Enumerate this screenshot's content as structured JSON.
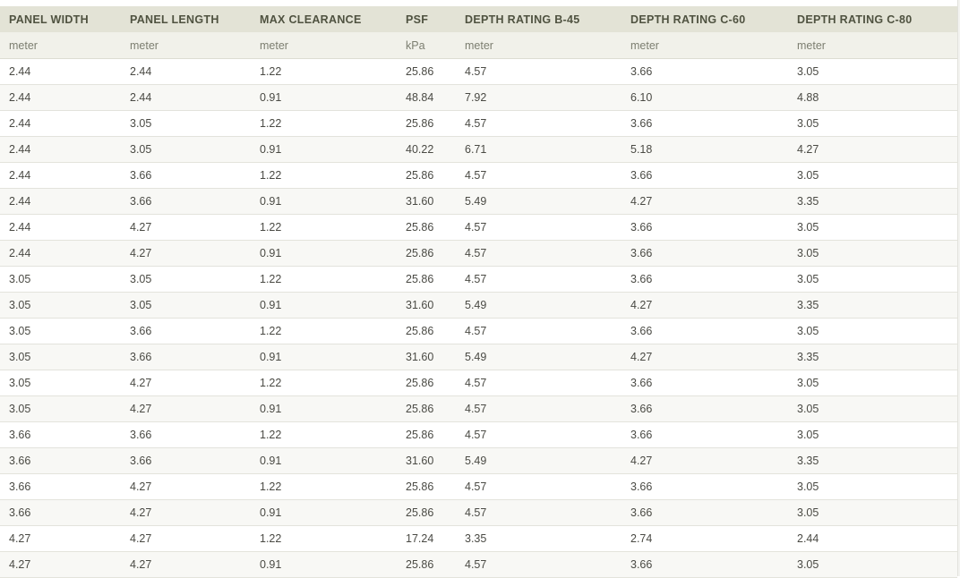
{
  "table": {
    "headers": [
      "PANEL WIDTH",
      "PANEL LENGTH",
      "MAX CLEARANCE",
      "PSF",
      "DEPTH RATING B-45",
      "DEPTH RATING C-60",
      "DEPTH RATING C-80"
    ],
    "units": [
      "meter",
      "meter",
      "meter",
      "kPa",
      "meter",
      "meter",
      "meter"
    ],
    "rows": [
      [
        "2.44",
        "2.44",
        "1.22",
        "25.86",
        "4.57",
        "3.66",
        "3.05"
      ],
      [
        "2.44",
        "2.44",
        "0.91",
        "48.84",
        "7.92",
        "6.10",
        "4.88"
      ],
      [
        "2.44",
        "3.05",
        "1.22",
        "25.86",
        "4.57",
        "3.66",
        "3.05"
      ],
      [
        "2.44",
        "3.05",
        "0.91",
        "40.22",
        "6.71",
        "5.18",
        "4.27"
      ],
      [
        "2.44",
        "3.66",
        "1.22",
        "25.86",
        "4.57",
        "3.66",
        "3.05"
      ],
      [
        "2.44",
        "3.66",
        "0.91",
        "31.60",
        "5.49",
        "4.27",
        "3.35"
      ],
      [
        "2.44",
        "4.27",
        "1.22",
        "25.86",
        "4.57",
        "3.66",
        "3.05"
      ],
      [
        "2.44",
        "4.27",
        "0.91",
        "25.86",
        "4.57",
        "3.66",
        "3.05"
      ],
      [
        "3.05",
        "3.05",
        "1.22",
        "25.86",
        "4.57",
        "3.66",
        "3.05"
      ],
      [
        "3.05",
        "3.05",
        "0.91",
        "31.60",
        "5.49",
        "4.27",
        "3.35"
      ],
      [
        "3.05",
        "3.66",
        "1.22",
        "25.86",
        "4.57",
        "3.66",
        "3.05"
      ],
      [
        "3.05",
        "3.66",
        "0.91",
        "31.60",
        "5.49",
        "4.27",
        "3.35"
      ],
      [
        "3.05",
        "4.27",
        "1.22",
        "25.86",
        "4.57",
        "3.66",
        "3.05"
      ],
      [
        "3.05",
        "4.27",
        "0.91",
        "25.86",
        "4.57",
        "3.66",
        "3.05"
      ],
      [
        "3.66",
        "3.66",
        "1.22",
        "25.86",
        "4.57",
        "3.66",
        "3.05"
      ],
      [
        "3.66",
        "3.66",
        "0.91",
        "31.60",
        "5.49",
        "4.27",
        "3.35"
      ],
      [
        "3.66",
        "4.27",
        "1.22",
        "25.86",
        "4.57",
        "3.66",
        "3.05"
      ],
      [
        "3.66",
        "4.27",
        "0.91",
        "25.86",
        "4.57",
        "3.66",
        "3.05"
      ],
      [
        "4.27",
        "4.27",
        "1.22",
        "17.24",
        "3.35",
        "2.74",
        "2.44"
      ],
      [
        "4.27",
        "4.27",
        "0.91",
        "25.86",
        "4.57",
        "3.66",
        "3.05"
      ]
    ]
  },
  "colors": {
    "header_bg": "#e3e3d6",
    "header_text": "#4f5240",
    "unit_bg": "#f1f1ea",
    "unit_text": "#7c7e70",
    "cell_text": "#4a4a44",
    "row_border": "#e3e3dc"
  }
}
